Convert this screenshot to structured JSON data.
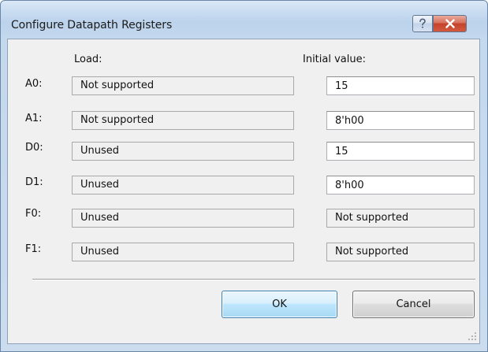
{
  "window": {
    "title": "Configure Datapath Registers",
    "help_icon": "help-question-icon",
    "close_icon": "close-x-icon"
  },
  "columns": {
    "load": "Load:",
    "initial": "Initial value:"
  },
  "rows": [
    {
      "label": "A0:",
      "load": "Not supported",
      "initial": "15",
      "initial_editable": true
    },
    {
      "label": "A1:",
      "load": "Not supported",
      "initial": "8'h00",
      "initial_editable": true
    },
    {
      "label": "D0:",
      "load": "Unused",
      "initial": "15",
      "initial_editable": true
    },
    {
      "label": "D1:",
      "load": "Unused",
      "initial": "8'h00",
      "initial_editable": true
    },
    {
      "label": "F0:",
      "load": "Unused",
      "initial": "Not supported",
      "initial_editable": false
    },
    {
      "label": "F1:",
      "load": "Unused",
      "initial": "Not supported",
      "initial_editable": false
    }
  ],
  "buttons": {
    "ok": "OK",
    "cancel": "Cancel"
  },
  "colors": {
    "close_button": "#c4432a",
    "default_button_border": "#3c7fb1",
    "dialog_background": "#f0f0f0"
  }
}
